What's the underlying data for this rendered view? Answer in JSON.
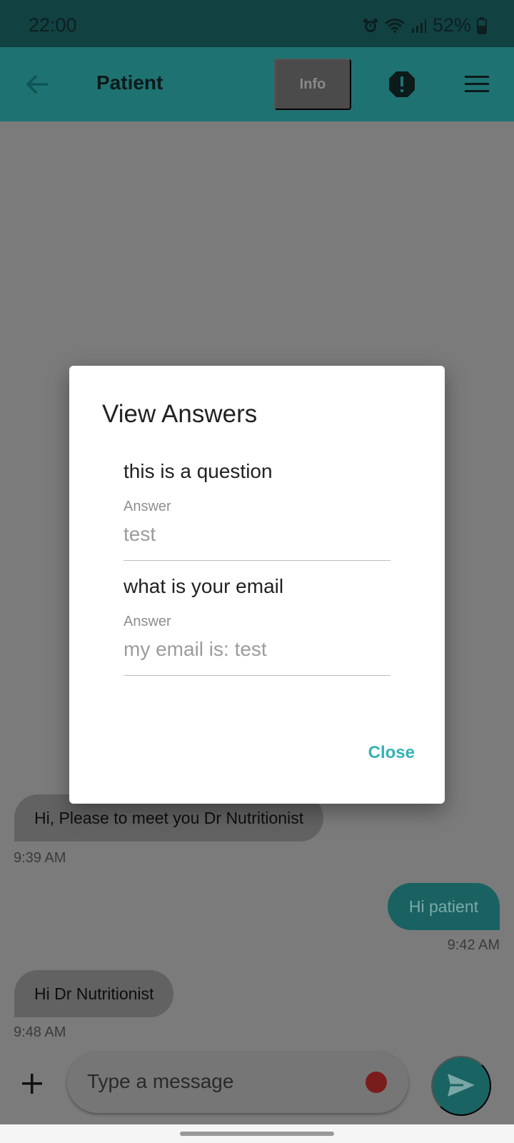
{
  "status_bar": {
    "time": "22:00",
    "battery": "52%",
    "icons": [
      "alarm-icon",
      "wifi-icon",
      "signal-icon",
      "battery-icon"
    ]
  },
  "app_bar": {
    "title": "Patient",
    "info_label": "Info",
    "icons": [
      "back-arrow-icon",
      "alert-octagon-icon",
      "menu-icon"
    ]
  },
  "messages": [
    {
      "direction": "incoming",
      "text": "Hi, Please to meet you Dr Nutritionist",
      "time": "9:39 AM"
    },
    {
      "direction": "outgoing",
      "text": "Hi patient",
      "time": "9:42 AM"
    },
    {
      "direction": "incoming",
      "text": "Hi Dr Nutritionist",
      "time": "9:48 AM"
    }
  ],
  "composer": {
    "placeholder": "Type a message",
    "icons": [
      "plus-icon",
      "record-icon",
      "send-icon"
    ]
  },
  "dialog": {
    "title": "View Answers",
    "items": [
      {
        "question": "this is a question",
        "label": "Answer",
        "answer": "test"
      },
      {
        "question": "what is your email",
        "label": "Answer",
        "answer": "my email is: test"
      }
    ],
    "close_label": "Close"
  },
  "colors": {
    "accent": "#33b3b3",
    "app_bar": "#1f7272",
    "scrim_background": "#7b7b7b",
    "record_dot": "#7b1c1c"
  }
}
